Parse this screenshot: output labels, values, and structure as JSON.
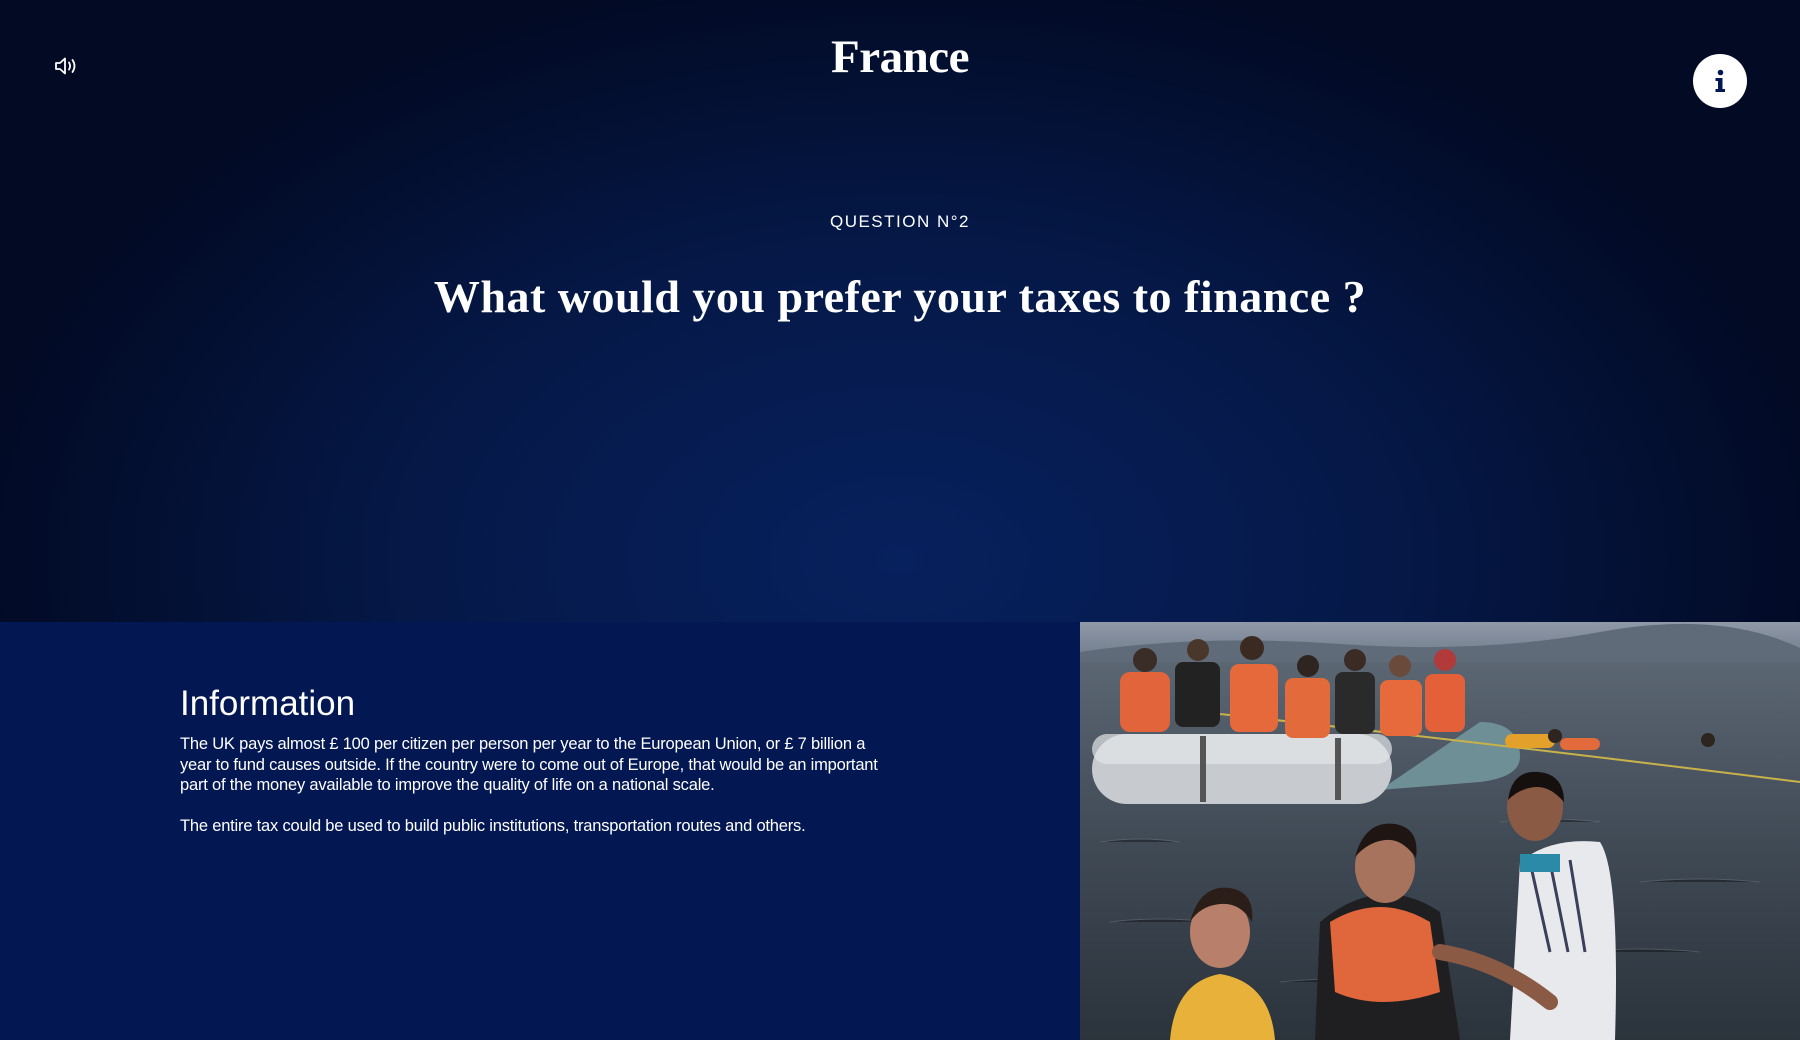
{
  "header": {
    "brand": "France",
    "sound_icon": "speaker-volume-icon",
    "info_icon": "info-icon"
  },
  "question": {
    "number_label": "QUESTION N°2",
    "text": "What would you prefer your taxes to finance ?"
  },
  "information": {
    "title": "Information",
    "paragraphs": [
      "The UK pays almost £ 100 per citizen per person per year to the European Union, or £ 7 billion a year to fund causes outside. If the country were to come out of Europe, that would be an important part of the money available to improve the quality of life on a national scale.",
      "The entire tax could be used to build public institutions, transportation routes and others."
    ]
  },
  "photo": {
    "subject": "migrants-boat-photo"
  },
  "colors": {
    "hero_dark": "#020a24",
    "hero_mid": "#07215e",
    "panel": "#031852",
    "text": "#ffffff",
    "info_button_icon": "#031852"
  }
}
